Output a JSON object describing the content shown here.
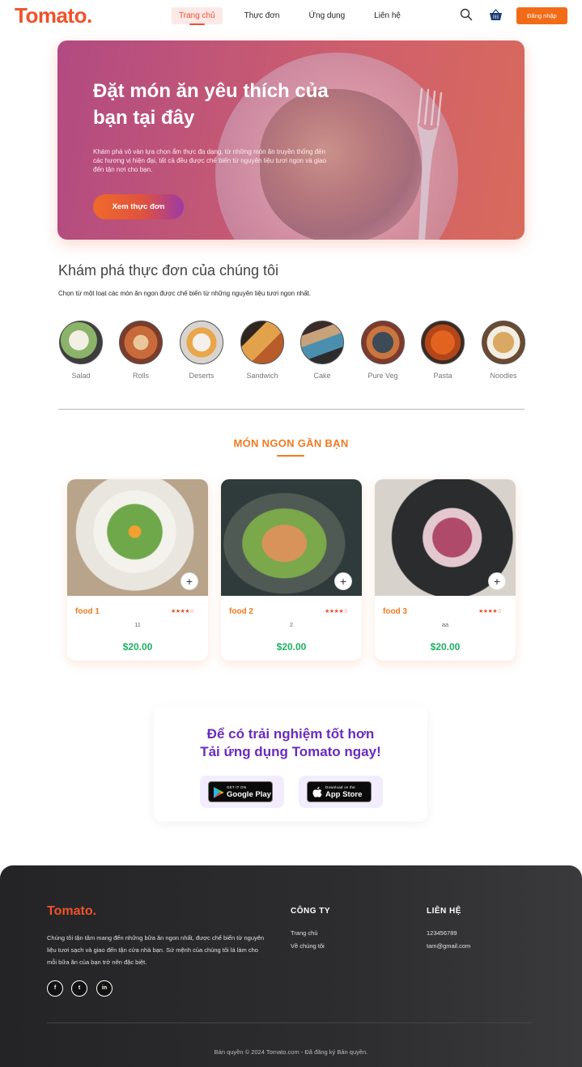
{
  "brand": {
    "logo": "Tomato.",
    "accent": "#f0522a"
  },
  "nav": {
    "items": [
      {
        "label": "Trang chủ",
        "active": true
      },
      {
        "label": "Thực đơn",
        "active": false
      },
      {
        "label": "Ứng dụng",
        "active": false
      },
      {
        "label": "Liên hệ",
        "active": false
      }
    ],
    "search_icon": "search-icon",
    "basket_icon": "basket-icon",
    "login_label": "Đăng nhập"
  },
  "hero": {
    "title": "Đặt món ăn yêu thích của bạn tại đây",
    "description": "Khám phá vô vàn lựa chọn ẩm thực đa dạng, từ những món ăn truyền thống đến các hương vị hiện đại, tất cả đều được chế biến từ nguyên liệu tươi ngon và giao đến tận nơi cho bạn.",
    "button_label": "Xem thực đơn"
  },
  "explore": {
    "title": "Khám phá thực đơn của chúng tôi",
    "subtitle": "Chọn từ một loạt các món ăn ngon được chế biến từ những nguyên liệu tươi ngon nhất.",
    "categories": [
      {
        "label": "Salad"
      },
      {
        "label": "Rolls"
      },
      {
        "label": "Deserts"
      },
      {
        "label": "Sandwich"
      },
      {
        "label": "Cake"
      },
      {
        "label": "Pure Veg"
      },
      {
        "label": "Pasta"
      },
      {
        "label": "Noodles"
      }
    ]
  },
  "near": {
    "title": "MÓN NGON GẦN BẠN",
    "foods": [
      {
        "name": "food 1",
        "desc": "11",
        "price": "$20.00",
        "rating": 4,
        "stars": "★★★★☆"
      },
      {
        "name": "food 2",
        "desc": "2",
        "price": "$20.00",
        "rating": 4,
        "stars": "★★★★☆"
      },
      {
        "name": "food 3",
        "desc": "aa",
        "price": "$20.00",
        "rating": 4,
        "stars": "★★★★☆"
      }
    ],
    "add_symbol": "+"
  },
  "app": {
    "title_line1": "Để có trải nghiệm tốt hơn",
    "title_line2": "Tải ứng dụng Tomato ngay!",
    "google": {
      "small": "GET IT ON",
      "big": "Google Play"
    },
    "apple": {
      "small": "Download on the",
      "big": "App Store"
    }
  },
  "footer": {
    "logo": "Tomato.",
    "about": "Chúng tôi tận tâm mang đến những bữa ăn ngon nhất, được chế biến từ nguyên liệu tươi sạch và giao đến tận cửa nhà bạn. Sứ mệnh của chúng tôi là làm cho mỗi bữa ăn của bạn trở nên đặc biệt.",
    "social": [
      {
        "icon": "facebook-icon",
        "glyph": "f"
      },
      {
        "icon": "twitter-icon",
        "glyph": "t"
      },
      {
        "icon": "linkedin-icon",
        "glyph": "in"
      }
    ],
    "company": {
      "title": "CÔNG TY",
      "links": [
        "Trang chủ",
        "Về chúng tôi"
      ]
    },
    "contact": {
      "title": "LIÊN HỆ",
      "items": [
        "123456789",
        "tam@gmail.com"
      ]
    },
    "copyright": "Bản quyền © 2024 Tomato.com - Đã đăng ký Bản quyền."
  }
}
